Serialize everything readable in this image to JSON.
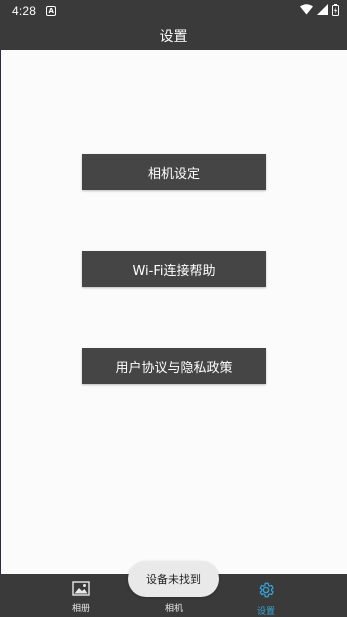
{
  "status_bar": {
    "time": "4:28",
    "notification_icon": "a-badge-icon"
  },
  "app_bar": {
    "title": "设置"
  },
  "buttons": {
    "camera_settings": "相机设定",
    "wifi_help": "Wi-Fi连接帮助",
    "privacy_policy": "用户协议与隐私政策"
  },
  "bottom_nav": {
    "items": [
      {
        "label": "相册",
        "icon": "image-icon",
        "active": false
      },
      {
        "label": "相机",
        "icon": "camera-icon",
        "active": false
      },
      {
        "label": "设置",
        "icon": "gear-icon",
        "active": true
      }
    ]
  },
  "toast": {
    "text": "设备未找到"
  },
  "colors": {
    "bar": "#3a3a3a",
    "button": "#454545",
    "background": "#fbfbfb",
    "active": "#35a6d8",
    "toast": "#e9e9e9"
  }
}
